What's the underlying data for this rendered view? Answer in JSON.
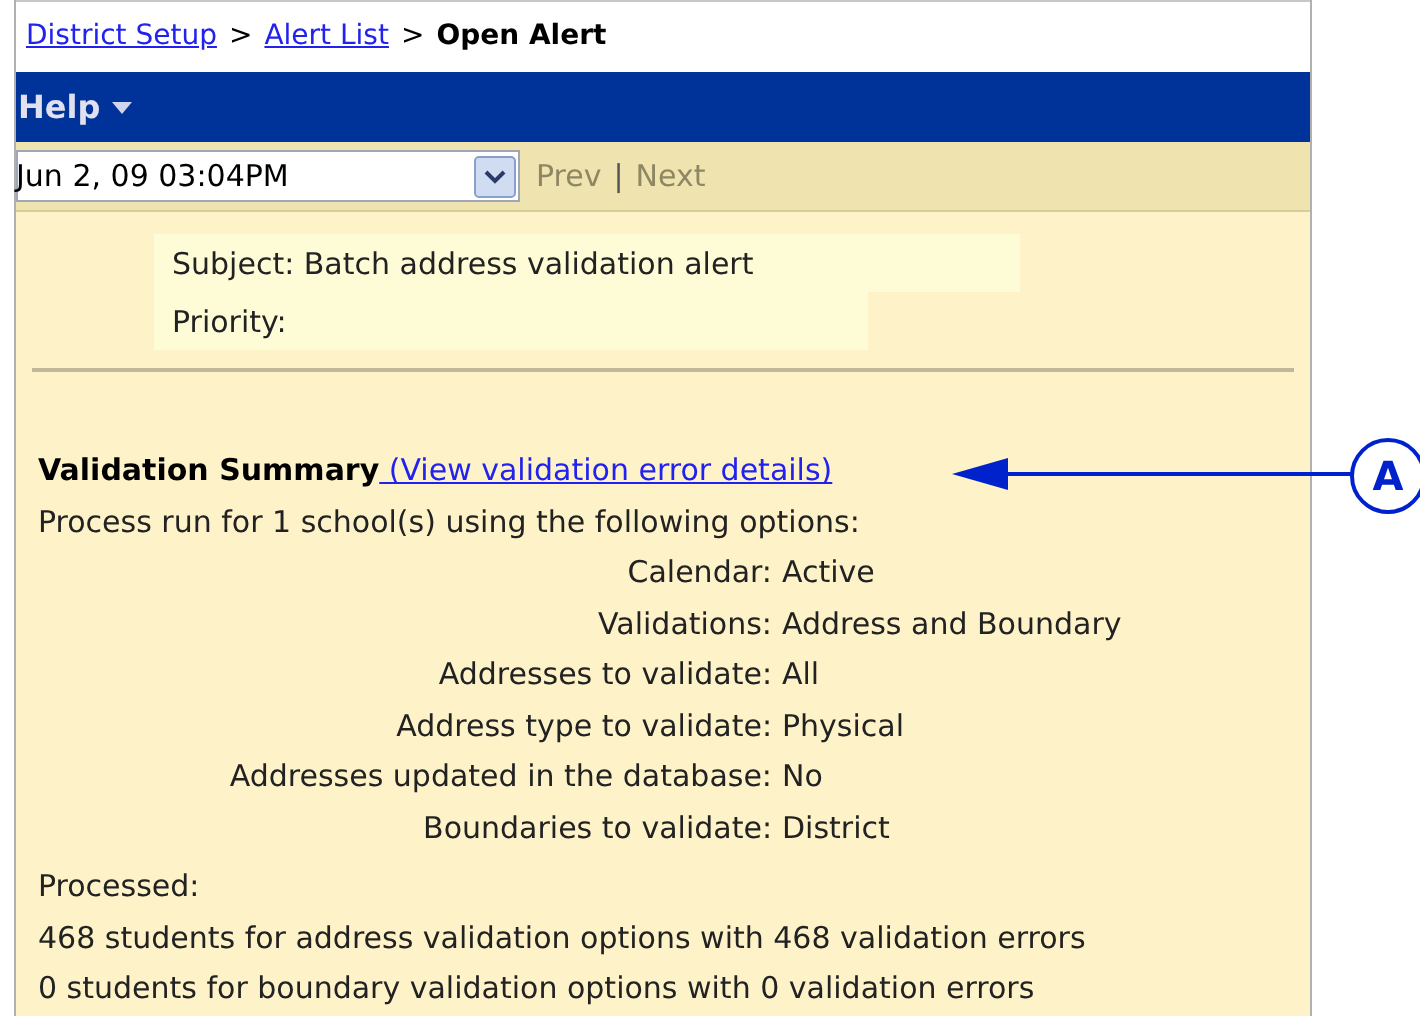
{
  "breadcrumb": [
    {
      "label": "District Setup",
      "kind": "link"
    },
    {
      "label": "Alert List",
      "kind": "link"
    },
    {
      "label": "Open Alert",
      "kind": "current"
    }
  ],
  "breadcrumb_separator": ">",
  "menu_bar": {
    "items": [
      {
        "label": "Help"
      }
    ]
  },
  "toolbar": {
    "date_select": {
      "value": "Jun 2, 09 03:04PM"
    },
    "prev": {
      "label": "Prev",
      "disabled": true
    },
    "separator": "|",
    "next": {
      "label": "Next",
      "disabled": true
    }
  },
  "alert_header": {
    "subject": "Subject: Batch address validation alert",
    "priority": "Priority:"
  },
  "summary": {
    "title": "Validation Summary",
    "details_link": " (View validation error details)",
    "intro": "Process run for 1 school(s) using the following options:",
    "options": [
      {
        "label": "Calendar:",
        "value": "Active"
      },
      {
        "label": "Validations:",
        "value": "Address and Boundary"
      },
      {
        "label": "Addresses to validate:",
        "value": "All"
      },
      {
        "label": "Address type to validate:",
        "value": "Physical"
      },
      {
        "label": "Addresses updated in the database:",
        "value": "No"
      },
      {
        "label": "Boundaries to validate:",
        "value": "District"
      }
    ],
    "processed_heading": "Processed:",
    "processed_lines": [
      "468 students for address validation options with 468 validation errors",
      "0 students for boundary validation options with 0 validation errors"
    ]
  },
  "callout": {
    "label": "A"
  }
}
